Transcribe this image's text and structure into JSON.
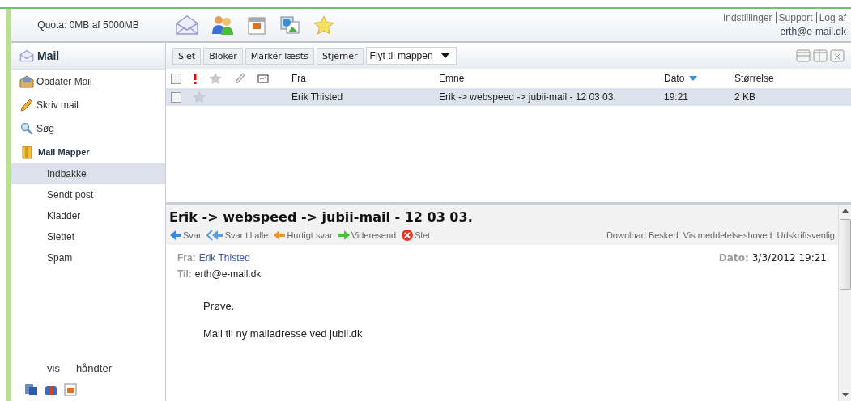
{
  "header": {
    "quota": "Quota: 0MB af 5000MB",
    "links": [
      "Indstillinger",
      "Support",
      "Log af"
    ],
    "user": "erth@e-mail.dk"
  },
  "sidebar": {
    "title": "Mail",
    "actions": [
      {
        "label": "Opdater Mail",
        "kind": "update"
      },
      {
        "label": "Skriv mail",
        "kind": "compose"
      },
      {
        "label": "Søg",
        "kind": "search"
      }
    ],
    "folders_title": "Mail Mapper",
    "folders": [
      {
        "label": "Indbakke",
        "selected": true
      },
      {
        "label": "Sendt post",
        "selected": false
      },
      {
        "label": "Kladder",
        "selected": false
      },
      {
        "label": "Slettet",
        "selected": false
      },
      {
        "label": "Spam",
        "selected": false
      }
    ],
    "footer": [
      "vis",
      "håndter"
    ]
  },
  "toolbar": {
    "buttons": [
      "Slet",
      "Blokér",
      "Markér læsts",
      "Stjerner"
    ],
    "move": "Flyt til mappen"
  },
  "list": {
    "all_checked": false,
    "columns": [
      {
        "label": "Fra",
        "sorted": false
      },
      {
        "label": "Emne",
        "sorted": false
      },
      {
        "label": "Dato",
        "sorted": true
      },
      {
        "label": "Størrelse",
        "sorted": false
      }
    ],
    "rows": [
      {
        "from": "Erik Thisted",
        "subject": "Erik -> webspeed -> jubii-mail - 12 03 03.",
        "date": "19:21",
        "size": "2 KB",
        "selected": true,
        "checked": false
      }
    ]
  },
  "preview": {
    "title": "Erik -> webspeed -> jubii-mail - 12 03 03.",
    "actions": [
      {
        "label": "Svar",
        "kind": "reply"
      },
      {
        "label": "Svar til alle",
        "kind": "reply_all"
      },
      {
        "label": "Hurtigt svar",
        "kind": "quick"
      },
      {
        "label": "Videresend",
        "kind": "forward"
      },
      {
        "label": "Slet",
        "kind": "delete"
      }
    ],
    "links": [
      "Download Besked",
      "Vis meddelelseshoved",
      "Udskriftsvenlig"
    ],
    "from_label": "Fra:",
    "from": "Erik Thisted",
    "to_label": "Til:",
    "to": "erth@e-mail.dk",
    "date_label": "Dato:",
    "date": "3/3/2012 19:21",
    "body": [
      "Prøve.",
      "Mail til ny mailadresse ved jubii.dk"
    ]
  }
}
